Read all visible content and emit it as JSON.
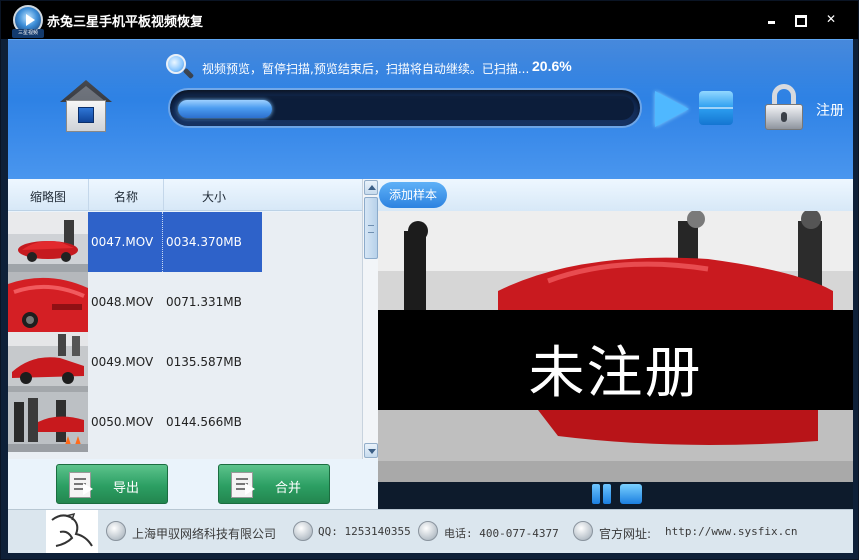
{
  "window": {
    "title": "赤兔三星手机平板视频恢复",
    "logo_label": "三星视频"
  },
  "header": {
    "scan_status": "视频预览，暂停扫描,预览结束后，扫描将自动继续。已扫描...",
    "scan_percent": "20.6%",
    "progress": 0.206,
    "register_label": "注册"
  },
  "file_list": {
    "columns": [
      "缩略图",
      "名称",
      "大小"
    ],
    "rows": [
      {
        "name": "0047.MOV",
        "size": "0034.370MB",
        "selected": true
      },
      {
        "name": "0048.MOV",
        "size": "0071.331MB",
        "selected": false
      },
      {
        "name": "0049.MOV",
        "size": "0135.587MB",
        "selected": false
      },
      {
        "name": "0050.MOV",
        "size": "0144.566MB",
        "selected": false
      }
    ]
  },
  "actions": {
    "export_label": "导出",
    "merge_label": "合并"
  },
  "preview": {
    "add_sample_label": "添加样本",
    "watermark": "未注册"
  },
  "footer": {
    "company": "上海甲驭网络科技有限公司",
    "qq": "QQ: 1253140355",
    "phone": "电话: 400-077-4377",
    "website_label": "官方网址: ",
    "website": "http://www.sysfix.cn"
  },
  "colors": {
    "header_blue": "#2a7fe3",
    "selection_blue": "#2e62c9",
    "button_green": "#2c9f63",
    "title_bar": "#000000"
  },
  "icons": {
    "home": "home-icon",
    "search": "magnifier-icon",
    "play": "play-icon",
    "stop": "stop-icon",
    "lock": "lock-icon",
    "pause": "pause-icon"
  }
}
